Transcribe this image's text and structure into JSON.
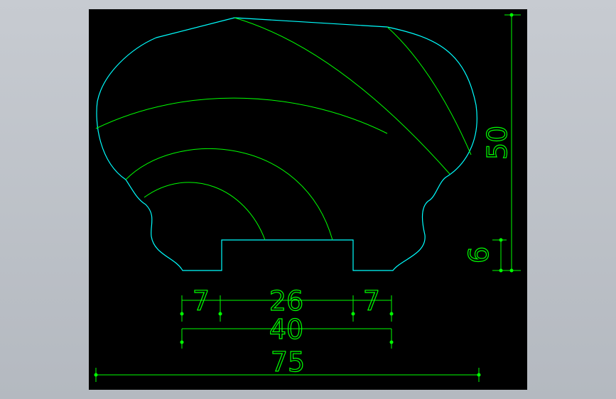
{
  "colors": {
    "background": "#000000",
    "outline": "#00ffff",
    "hatch": "#00ff00",
    "dimension": "#00ff00",
    "endpoint": "#00ff00",
    "frame": "#b9bec5"
  },
  "dimensions": {
    "left_step": "7",
    "tenon": "26",
    "right_step": "7",
    "base_width": "40",
    "overall_width": "75",
    "overall_height": "50",
    "tenon_height": "6"
  }
}
